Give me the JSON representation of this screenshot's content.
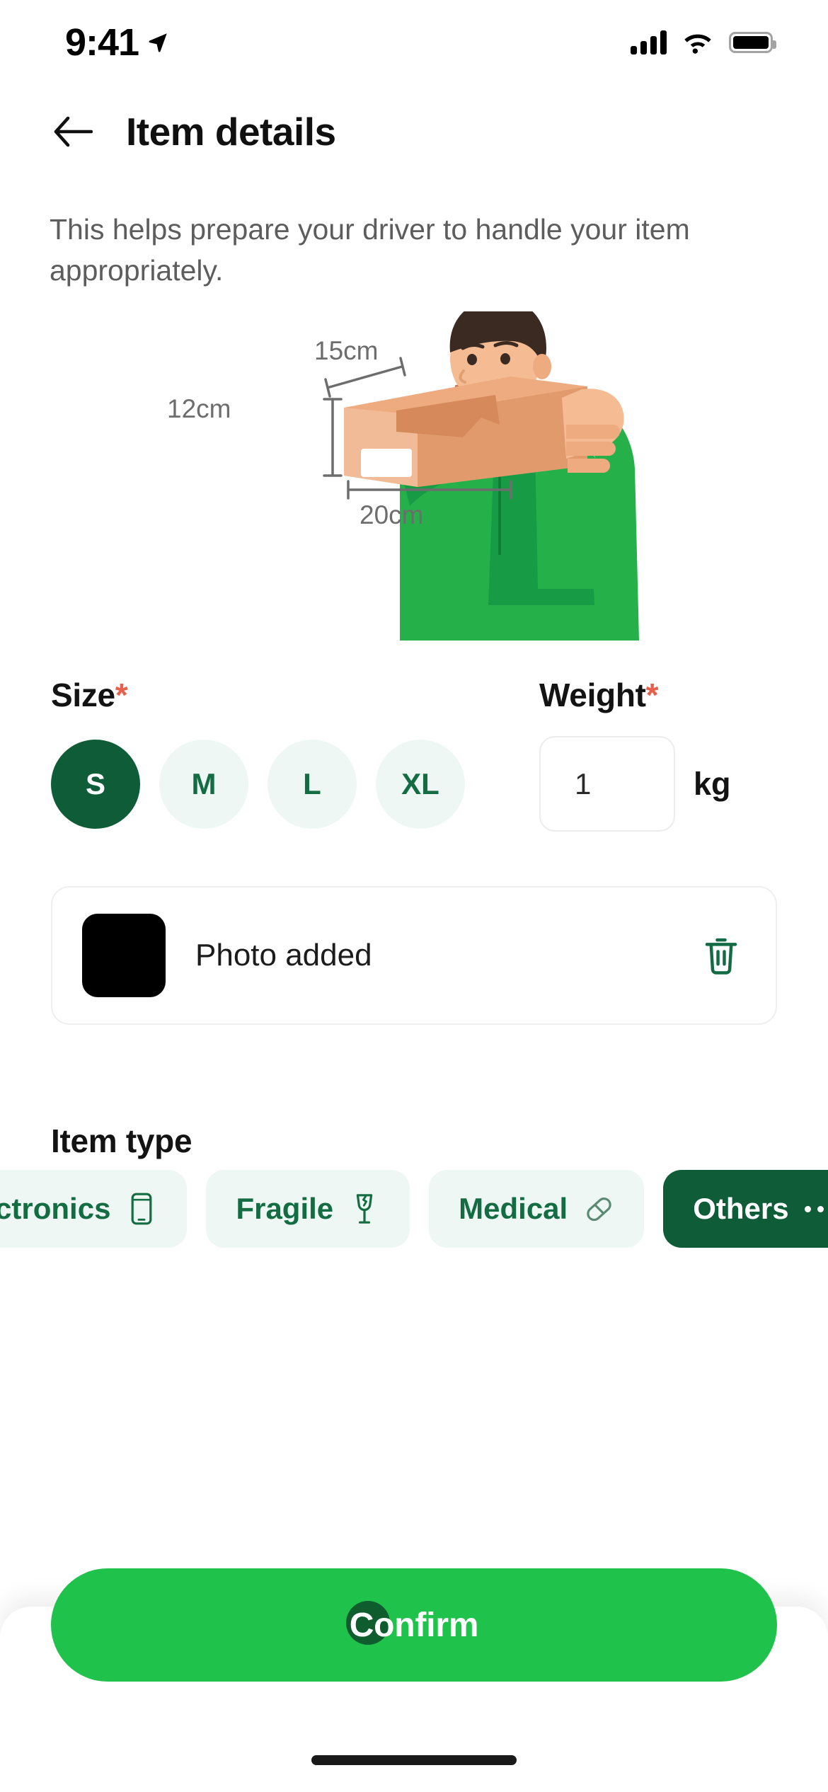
{
  "status_bar": {
    "time": "9:41",
    "location_icon": "location-arrow-icon",
    "signal_icon": "cellular-signal-icon",
    "wifi_icon": "wifi-icon",
    "battery_icon": "battery-full-icon"
  },
  "header": {
    "back_icon": "arrow-left-icon",
    "title": "Item details"
  },
  "subtitle": "This helps prepare your driver to handle your item appropriately.",
  "illustration": {
    "name": "courier-holding-parcel-illustration",
    "dim_depth": "15cm",
    "dim_height": "12cm",
    "dim_width": "20cm",
    "uniform_color": "#25b04a",
    "uniform_shade": "#179b44",
    "box_color": "#efab80"
  },
  "size": {
    "label": "Size",
    "required_mark": "*",
    "options": [
      {
        "label": "S",
        "selected": true
      },
      {
        "label": "M",
        "selected": false
      },
      {
        "label": "L",
        "selected": false
      },
      {
        "label": "XL",
        "selected": false
      }
    ]
  },
  "weight": {
    "label": "Weight",
    "required_mark": "*",
    "value": "1",
    "placeholder": "1",
    "unit": "kg"
  },
  "photo": {
    "text": "Photo added",
    "thumbnail_color": "#000000",
    "delete_icon": "trash-icon"
  },
  "item_type": {
    "label": "Item type",
    "options": [
      {
        "label": "Electronics",
        "icon": "phone-icon",
        "selected": false,
        "clipped": true
      },
      {
        "label": "Fragile",
        "icon": "wine-glass-icon",
        "selected": false,
        "clipped": false
      },
      {
        "label": "Medical",
        "icon": "pill-icon",
        "selected": false,
        "clipped": false
      },
      {
        "label": "Others",
        "icon": "ellipsis-icon",
        "selected": true,
        "clipped": false
      }
    ]
  },
  "footer": {
    "confirm_label": "Confirm"
  },
  "colors": {
    "brand_green": "#1fc24a",
    "dark_green": "#0e5c38",
    "mint": "#eef7f3",
    "required_red": "#e8604c",
    "text_primary": "#131313",
    "text_secondary": "#5d5d5d"
  }
}
